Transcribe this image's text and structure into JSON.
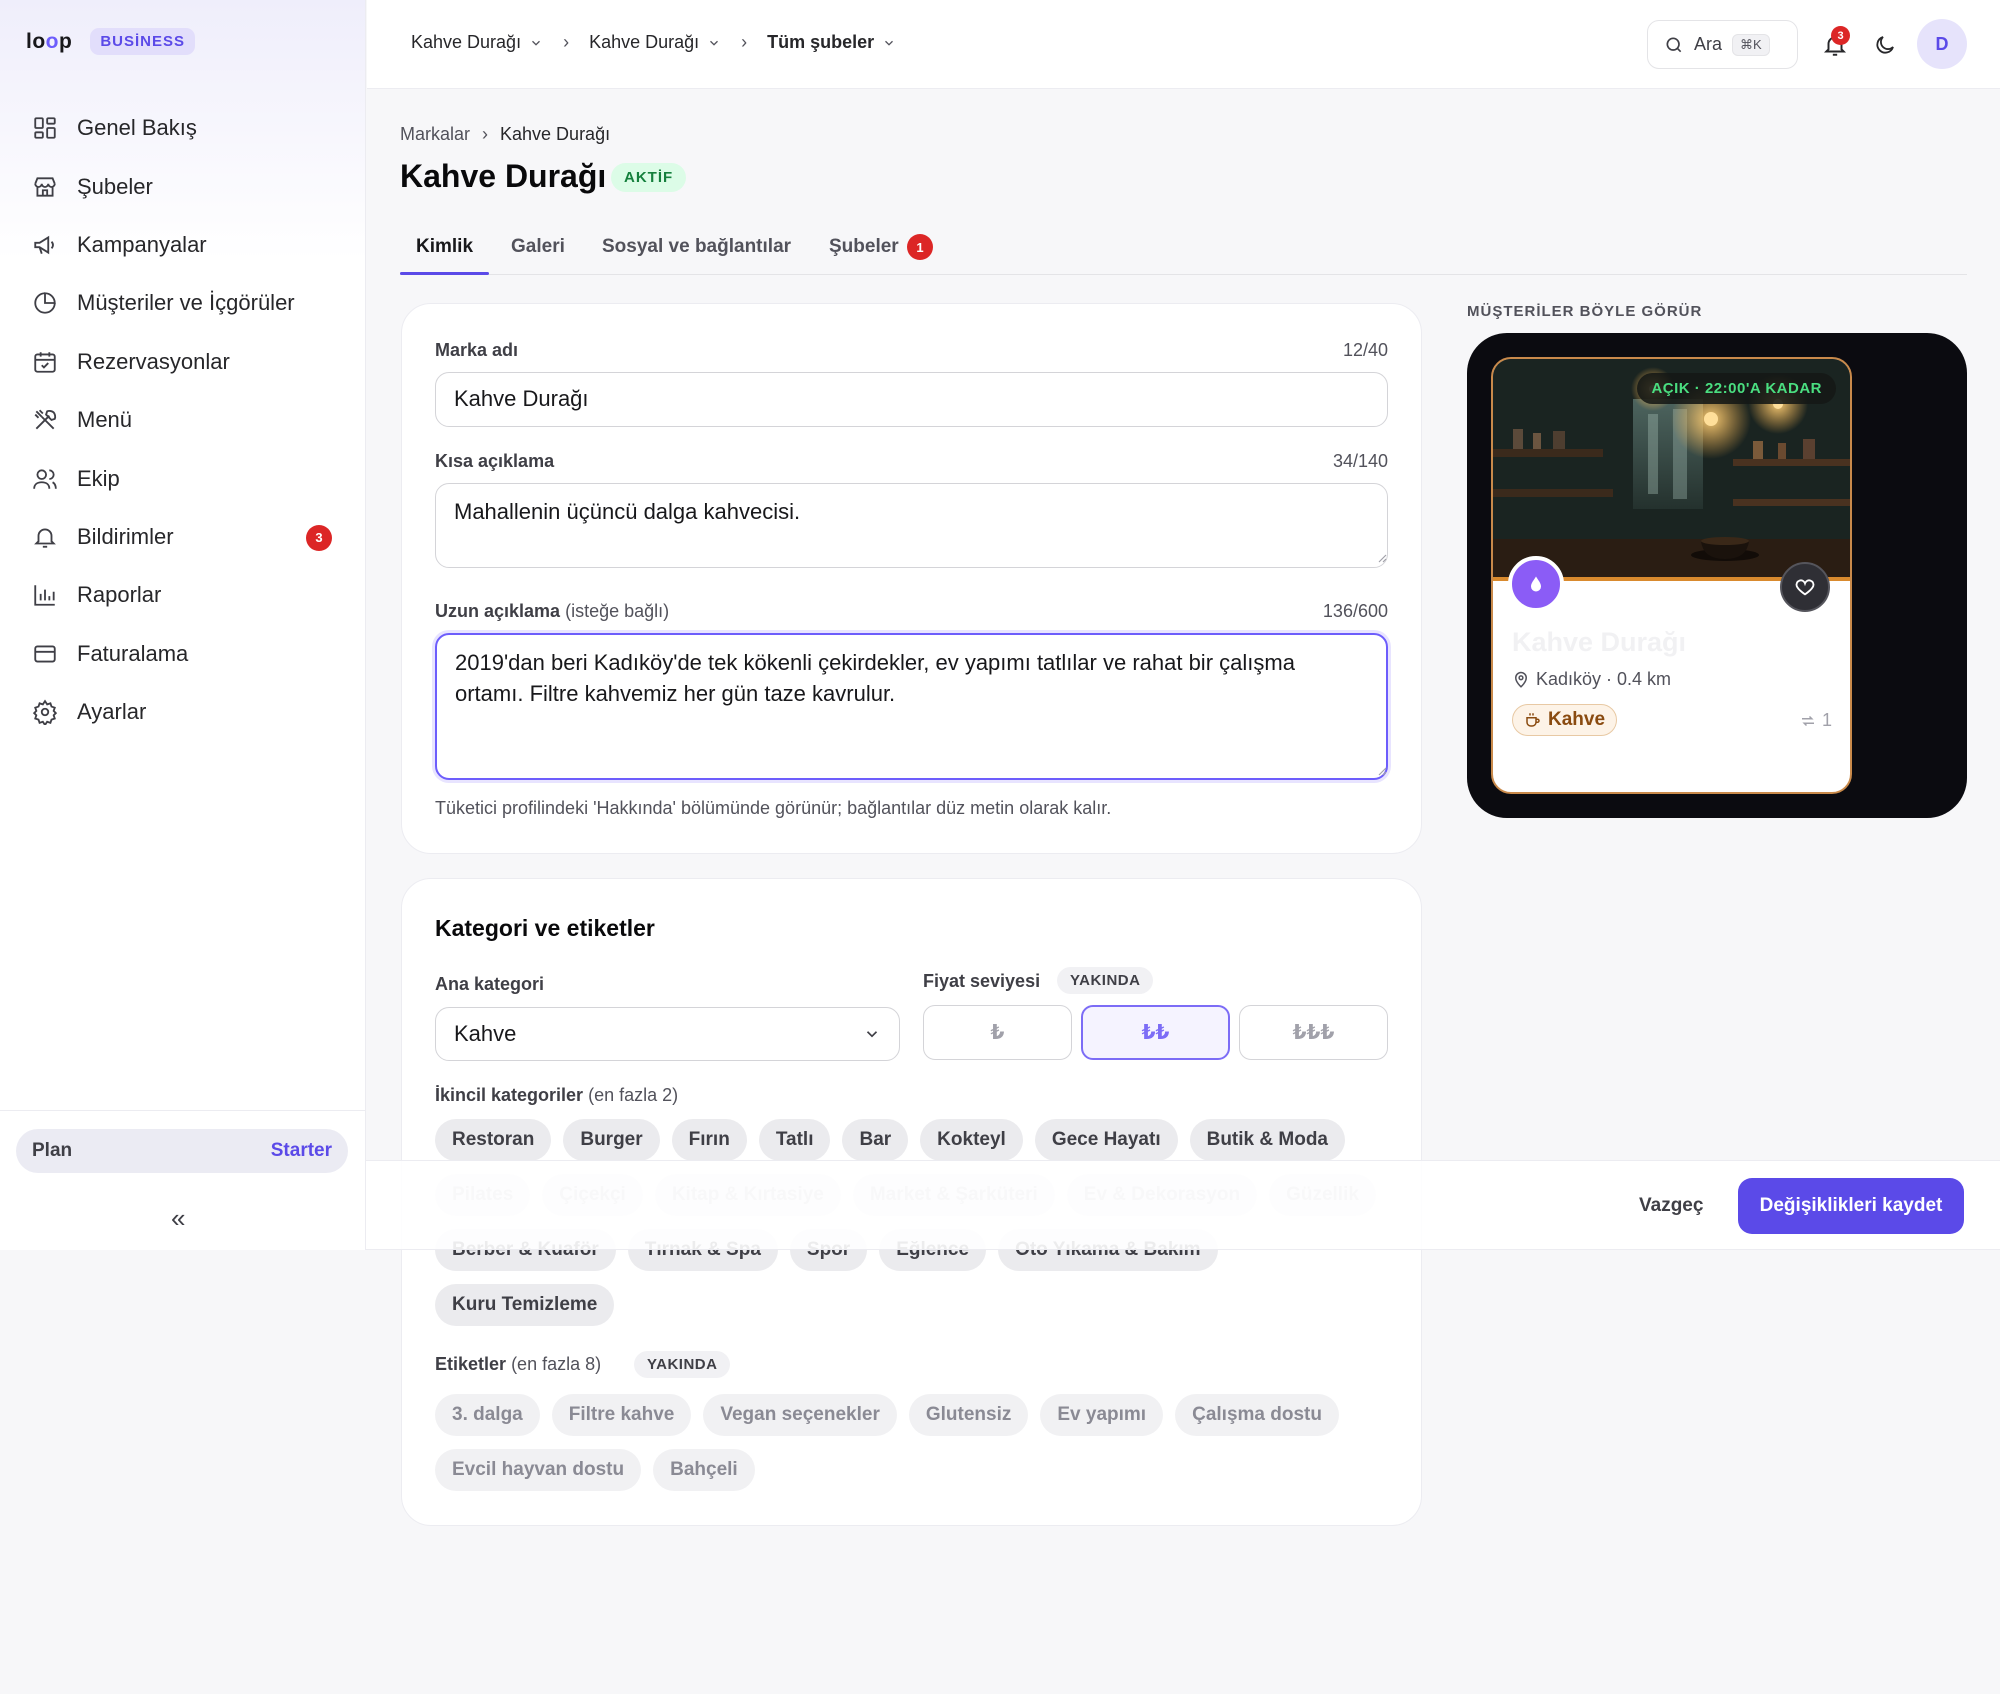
{
  "brand": {
    "logo": "loop",
    "badge": "BUSİNESS"
  },
  "sidebar": {
    "items": [
      {
        "label": "Genel Bakış",
        "icon": "grid-icon"
      },
      {
        "label": "Şubeler",
        "icon": "store-icon"
      },
      {
        "label": "Kampanyalar",
        "icon": "megaphone-icon"
      },
      {
        "label": "Müşteriler ve İçgörüler",
        "icon": "pie-chart-icon"
      },
      {
        "label": "Rezervasyonlar",
        "icon": "calendar-icon"
      },
      {
        "label": "Menü",
        "icon": "utensils-icon"
      },
      {
        "label": "Ekip",
        "icon": "users-icon"
      },
      {
        "label": "Bildirimler",
        "icon": "bell-icon",
        "badge": "3"
      },
      {
        "label": "Raporlar",
        "icon": "bar-chart-icon"
      },
      {
        "label": "Faturalama",
        "icon": "credit-card-icon"
      },
      {
        "label": "Ayarlar",
        "icon": "gear-icon"
      }
    ],
    "plan_label": "Plan",
    "plan_value": "Starter",
    "collapse_glyph": "«"
  },
  "topbar": {
    "crumbs": [
      "Kahve Durağı",
      "Kahve Durağı",
      "Tüm şubeler"
    ],
    "search_label": "Ara",
    "search_shortcut": "⌘K",
    "notif_count": "3",
    "avatar_initial": "D"
  },
  "page": {
    "breadcrumb": [
      "Markalar",
      "Kahve Durağı"
    ],
    "title": "Kahve Durağı",
    "status": "AKTİF",
    "tabs": [
      "Kimlik",
      "Galeri",
      "Sosyal ve bağlantılar",
      "Şubeler"
    ],
    "tab_badge": "1"
  },
  "identity": {
    "name_label": "Marka adı",
    "name_count": "12/40",
    "name_value": "Kahve Durağı",
    "short_label": "Kısa açıklama",
    "short_count": "34/140",
    "short_value": "Mahallenin üçüncü dalga kahvecisi.",
    "long_label": "Uzun açıklama",
    "long_optional": "(isteğe bağlı)",
    "long_count": "136/600",
    "long_value": "2019'dan beri Kadıköy'de tek kökenli çekirdekler, ev yapımı tatlılar ve rahat bir çalışma ortamı. Filtre kahvemiz her gün taze kavrulur.",
    "helper": "Tüketici profilindeki 'Hakkında' bölümünde görünür; bağlantılar düz metin olarak kalır."
  },
  "category": {
    "title": "Kategori ve etiketler",
    "main_label": "Ana kategori",
    "main_value": "Kahve",
    "price_label": "Fiyat seviyesi",
    "soon": "YAKINDA",
    "price_options": [
      "₺",
      "₺₺",
      "₺₺₺"
    ],
    "price_selected": 1,
    "secondary_label": "İkincil kategoriler",
    "secondary_hint": "(en fazla 2)",
    "secondary_row1": [
      "Restoran",
      "Burger",
      "Fırın",
      "Tatlı",
      "Bar",
      "Kokteyl",
      "Gece Hayatı",
      "Butik & Moda"
    ],
    "secondary_row2": [
      "Pilates",
      "Çiçekçi",
      "Kitap & Kırtasiye",
      "Market & Şarküteri",
      "Ev & Dekorasyon",
      "Güzellik"
    ],
    "secondary_row3": [
      "Berber & Kuaför",
      "Tırnak & Spa",
      "Spor",
      "Eğlence",
      "Oto Yıkama & Bakım"
    ],
    "secondary_row4": [
      "Kuru Temizleme"
    ],
    "tags_label": "Etiketler",
    "tags_hint": "(en fazla 8)",
    "tags_row1": [
      "3. dalga",
      "Filtre kahve",
      "Vegan seçenekler",
      "Glutensiz",
      "Ev yapımı",
      "Çalışma dostu"
    ],
    "tags_row2": [
      "Evcil hayvan dostu",
      "Bahçeli"
    ]
  },
  "preview": {
    "label": "MÜŞTERİLER BÖYLE GÖRÜR",
    "open_status": "AÇIK · 22:00'A KADAR",
    "name": "Kahve Durağı",
    "location": "Kadıköy · 0.4 km",
    "tag": "Kahve",
    "branches": "1"
  },
  "actions": {
    "cancel": "Vazgeç",
    "save": "Değişiklikleri kaydet"
  },
  "colors": {
    "accent": "#5b4ae8",
    "badge_red": "#dc2626",
    "active_green": "#15803d"
  }
}
